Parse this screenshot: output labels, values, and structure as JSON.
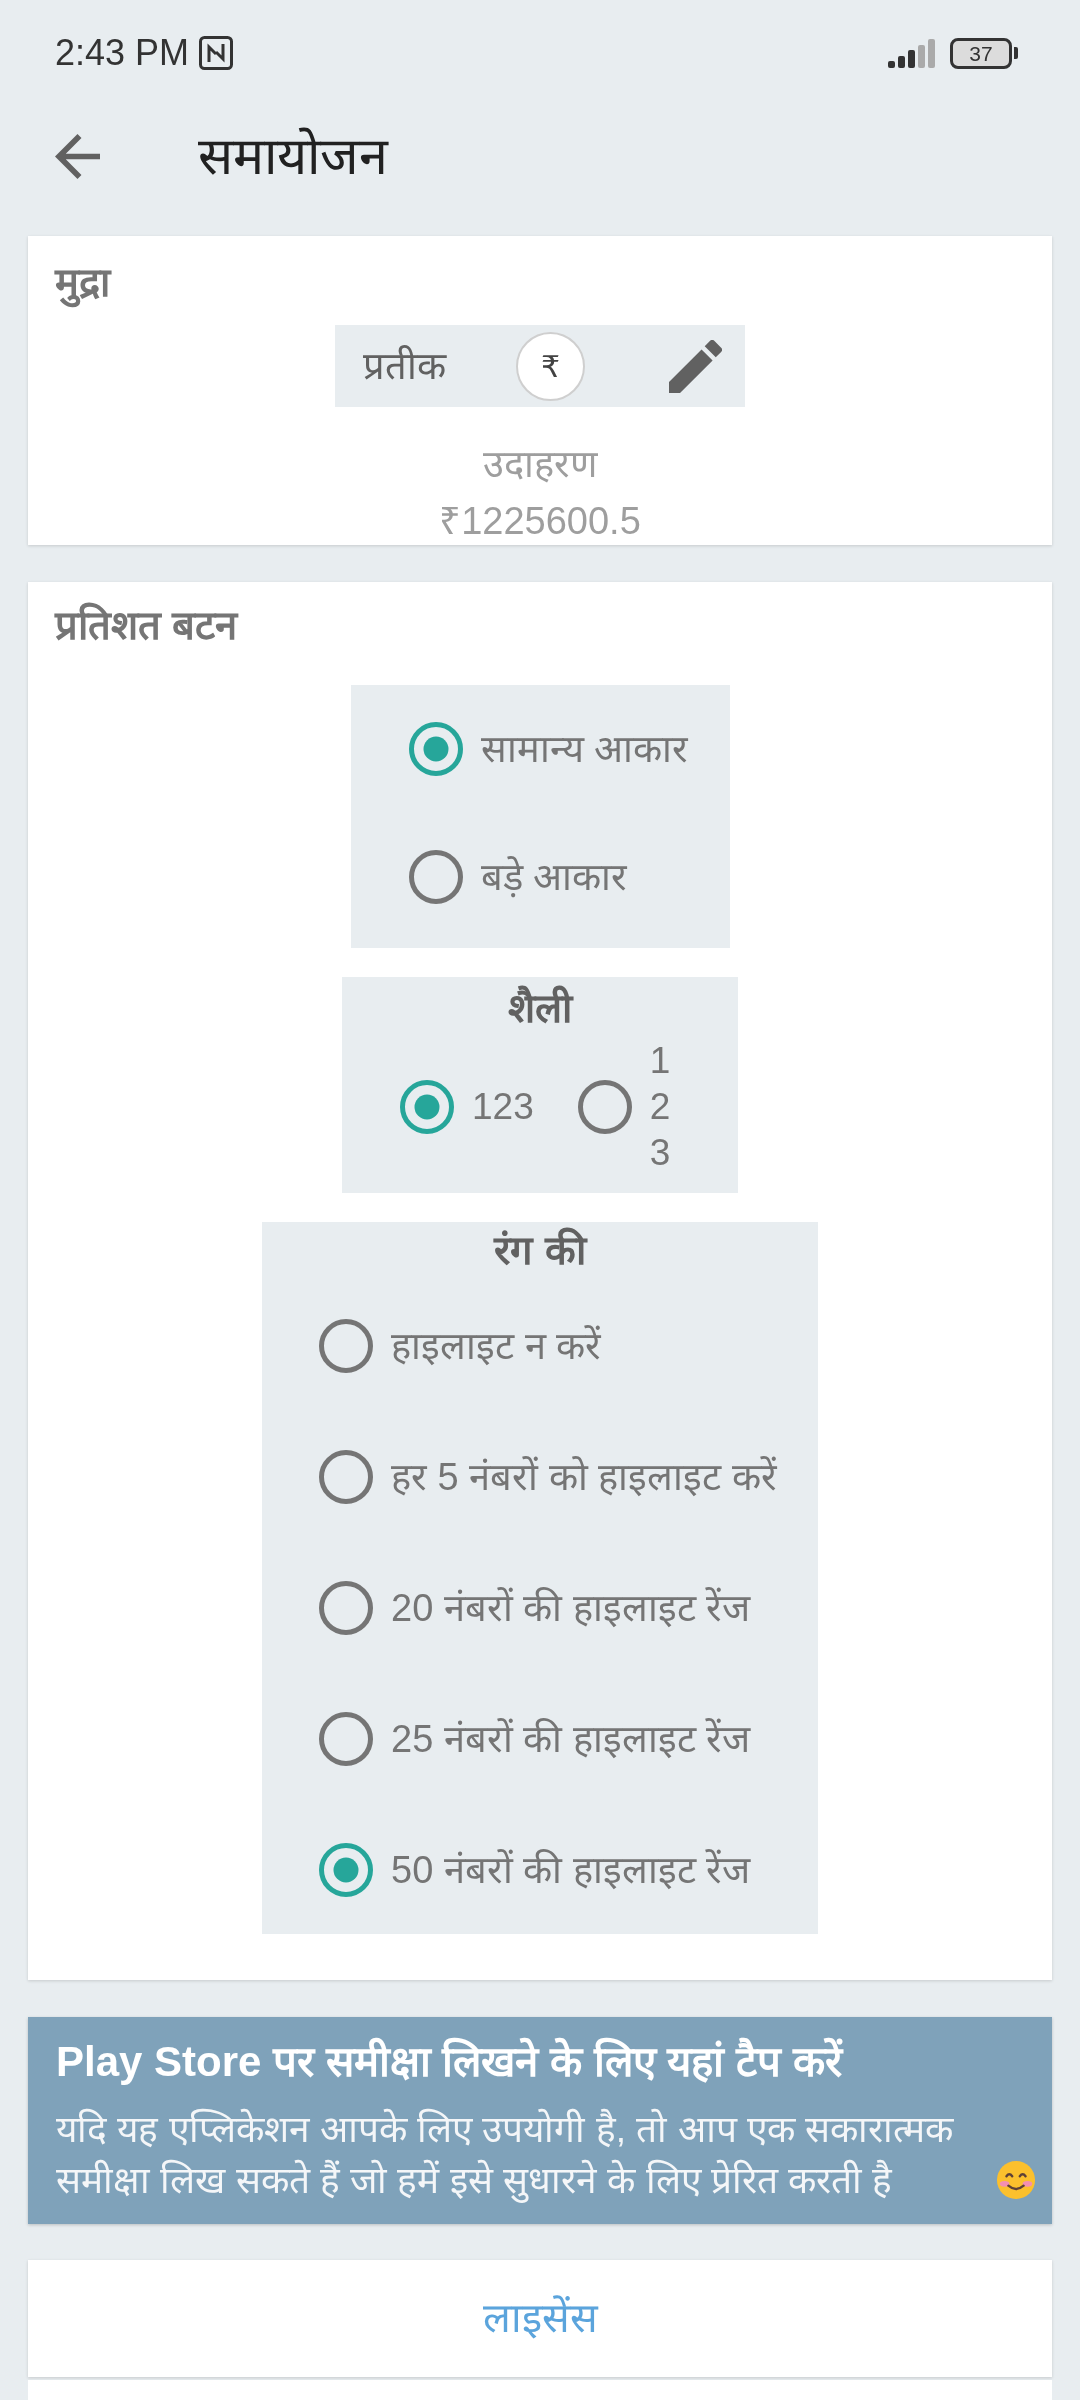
{
  "status_bar": {
    "time": "2:43 PM",
    "battery": "37"
  },
  "app_bar": {
    "title": "समायोजन"
  },
  "currency": {
    "title": "मुद्रा",
    "symbol_label": "प्रतीक",
    "symbol": "₹",
    "example_label": "उदाहरण",
    "example_value": "₹1225600.5"
  },
  "percent_buttons": {
    "title": "प्रतिशत बटन",
    "size_options": [
      {
        "label": "सामान्य आकार",
        "selected": true
      },
      {
        "label": "बड़े आकार",
        "selected": false
      }
    ],
    "style": {
      "title": "शैली",
      "options": [
        {
          "label": "123",
          "kind": "inline",
          "selected": true
        },
        {
          "label": "123",
          "kind": "stacked",
          "selected": false
        }
      ]
    },
    "color": {
      "title": "रंग की",
      "options": [
        {
          "label": "हाइलाइट न करें",
          "selected": false
        },
        {
          "label": "हर 5 नंबरों को हाइलाइट करें",
          "selected": false
        },
        {
          "label": "20 नंबरों की हाइलाइट रेंज",
          "selected": false
        },
        {
          "label": "25 नंबरों की हाइलाइट रेंज",
          "selected": false
        },
        {
          "label": "50 नंबरों की हाइलाइट रेंज",
          "selected": true
        }
      ]
    }
  },
  "review_banner": {
    "title": "Play Store पर समीक्षा लिखने के लिए यहां टैप करें",
    "text": "यदि यह एप्लिकेशन आपके लिए उपयोगी है, तो आप एक सकारात्मक समीक्षा लिख सकते हैं जो हमें इसे सुधारने के लिए प्रेरित करती है"
  },
  "license_button": {
    "label": "लाइसेंस"
  }
}
